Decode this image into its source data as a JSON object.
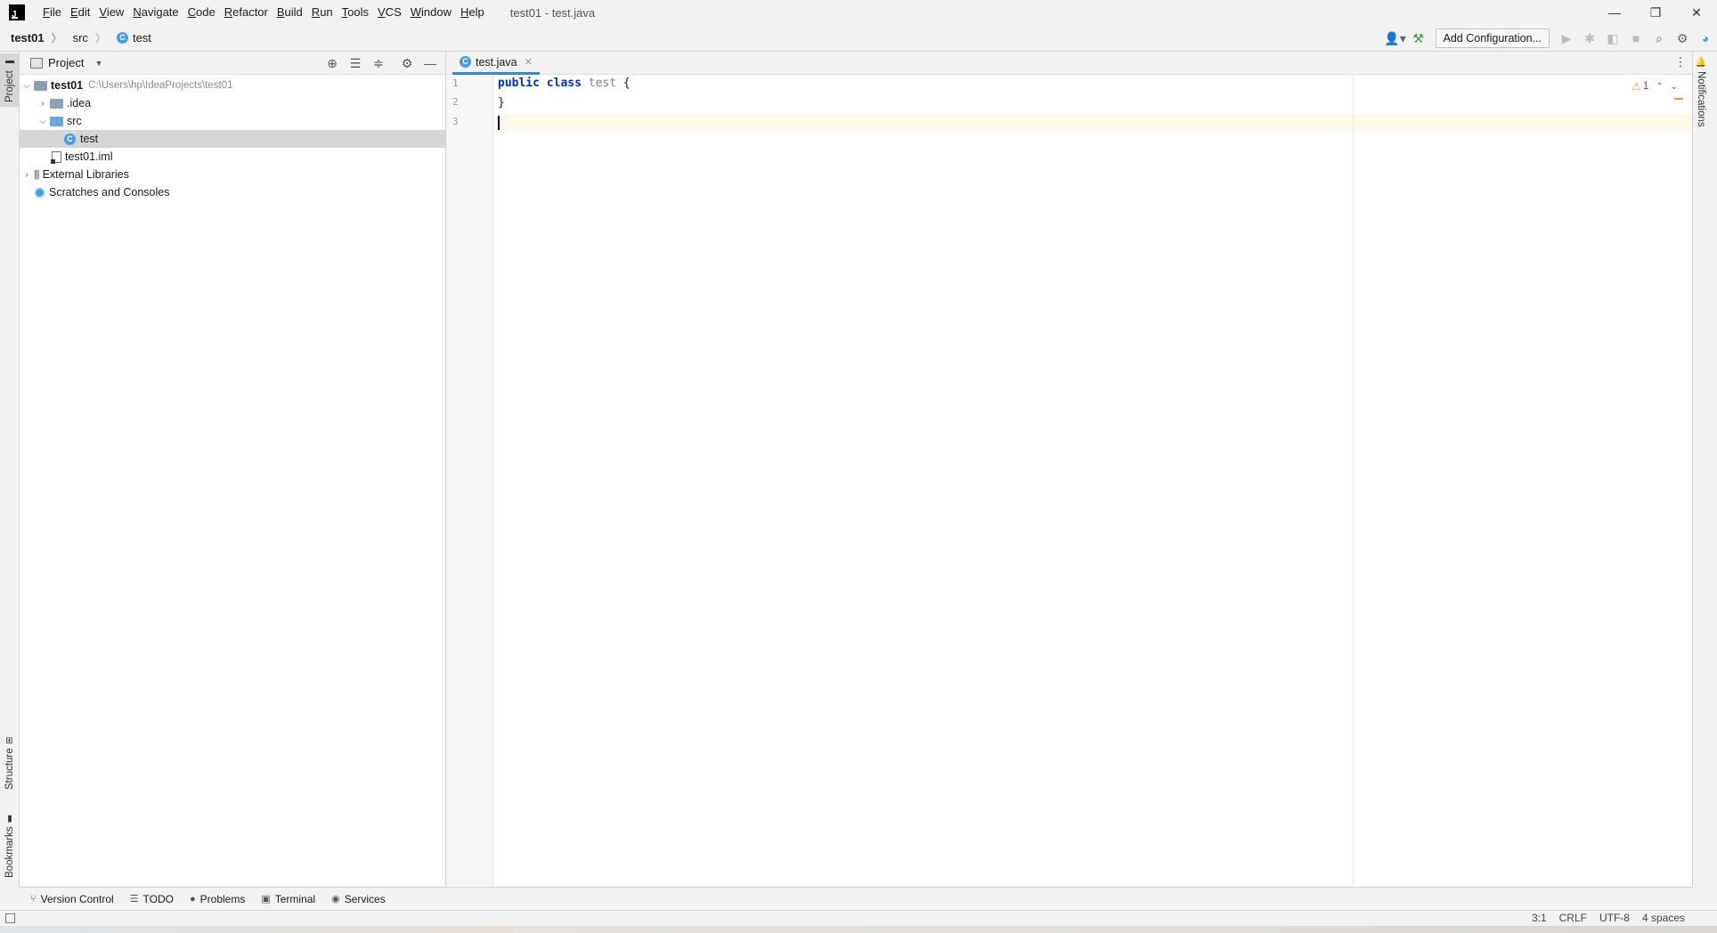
{
  "window": {
    "title": "test01 - test.java",
    "menu": [
      "File",
      "Edit",
      "View",
      "Navigate",
      "Code",
      "Refactor",
      "Build",
      "Run",
      "Tools",
      "VCS",
      "Window",
      "Help"
    ],
    "controls": {
      "minimize": "—",
      "restore": "❐",
      "close": "✕"
    }
  },
  "navbar": {
    "breadcrumbs": [
      "test01",
      "src",
      "test"
    ],
    "add_configuration": "Add Configuration..."
  },
  "left_strip": {
    "project": "Project",
    "structure": "Structure",
    "bookmarks": "Bookmarks"
  },
  "right_strip": {
    "notifications": "Notifications"
  },
  "project_panel": {
    "title": "Project",
    "tree": [
      {
        "label": "test01",
        "path": "C:\\Users\\hp\\IdeaProjects\\test01"
      },
      {
        "label": ".idea"
      },
      {
        "label": "src"
      },
      {
        "label": "test"
      },
      {
        "label": "test01.iml"
      },
      {
        "label": "External Libraries"
      },
      {
        "label": "Scratches and Consoles"
      }
    ]
  },
  "editor": {
    "tab": "test.java",
    "line_numbers": [
      "1",
      "2",
      "3"
    ],
    "code": {
      "line1_kw1": "public",
      "line1_kw2": "class",
      "line1_name": "test",
      "line1_brace": "{",
      "line2": "}"
    },
    "warnings_count": "1"
  },
  "bottom_bar": [
    "Version Control",
    "TODO",
    "Problems",
    "Terminal",
    "Services"
  ],
  "status_bar": {
    "position": "3:1",
    "line_sep": "CRLF",
    "encoding": "UTF-8",
    "indent": "4 spaces"
  }
}
